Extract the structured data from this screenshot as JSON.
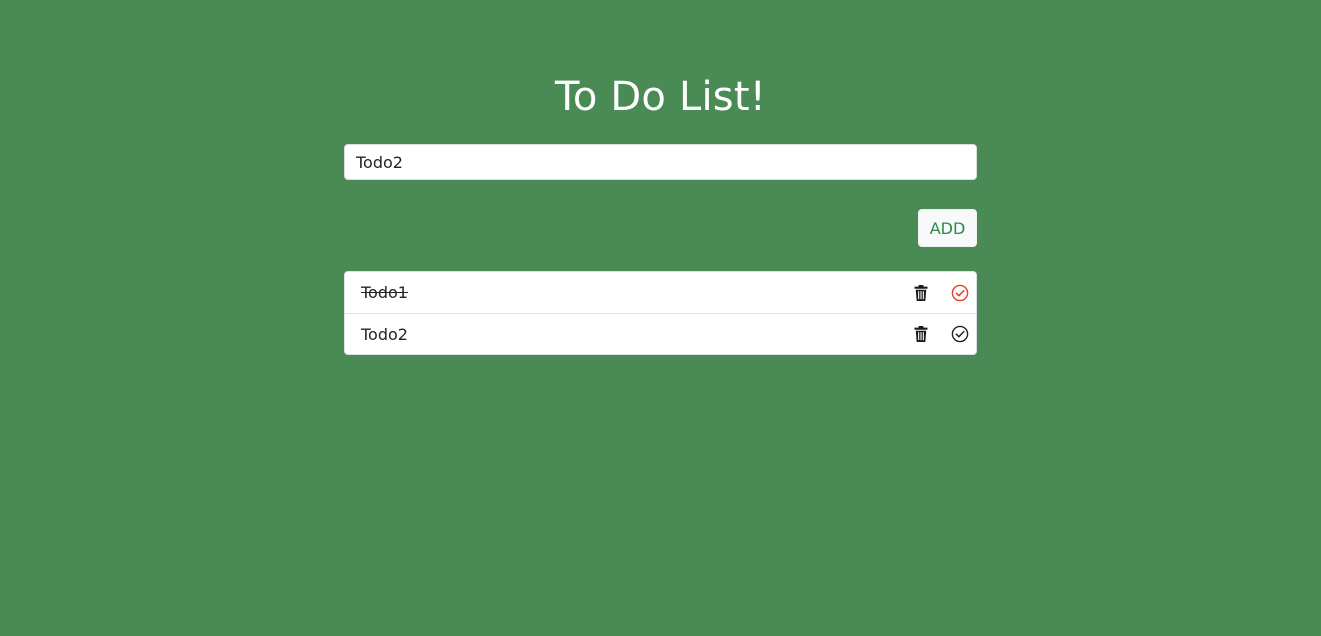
{
  "header": {
    "title": "To Do List!"
  },
  "form": {
    "input_value": "Todo2",
    "add_label": "ADD"
  },
  "todos": [
    {
      "text": "Todo1",
      "completed": true,
      "delete_icon": "trash-icon",
      "complete_icon": "check-circle-icon",
      "complete_icon_color": "#e0402a"
    },
    {
      "text": "Todo2",
      "completed": false,
      "delete_icon": "trash-icon",
      "complete_icon": "check-circle-icon",
      "complete_icon_color": "#212529"
    }
  ],
  "colors": {
    "background": "#498a55",
    "accent": "#2e8b45",
    "completed_icon": "#e0402a"
  }
}
